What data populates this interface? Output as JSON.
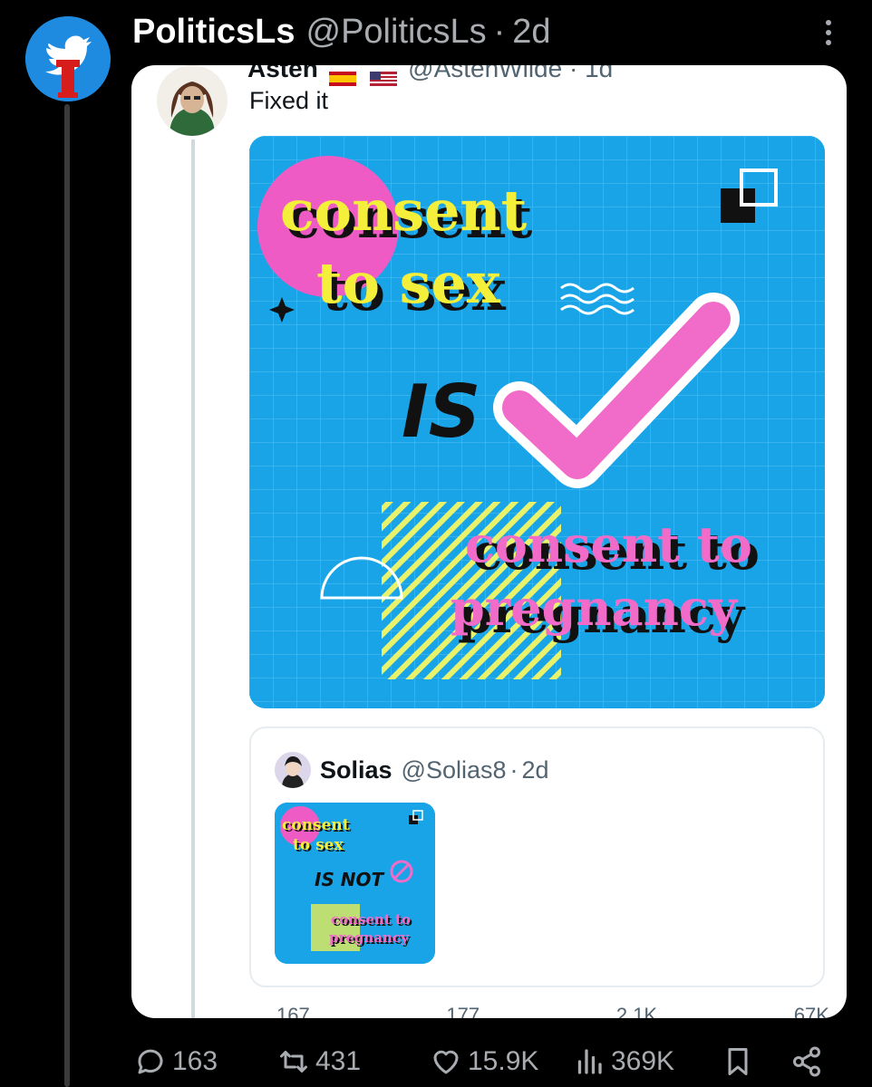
{
  "outer_tweet": {
    "name": "PoliticsLs",
    "handle": "@PoliticsLs",
    "separator": "·",
    "time": "2d"
  },
  "inner_tweet": {
    "name": "Asten",
    "handle": "@AstenWilde",
    "time": "1d",
    "text": "Fixed it"
  },
  "main_image": {
    "line1": "consent",
    "line2": "to sex",
    "middle": "IS",
    "line3": "consent to",
    "line4": "pregnancy"
  },
  "quote": {
    "name": "Solias",
    "handle": "@Solias8",
    "separator": "·",
    "time": "2d",
    "thumb_line1": "consent",
    "thumb_line2": "to sex",
    "thumb_middle": "IS NOT",
    "thumb_line3": "consent to",
    "thumb_line4": "pregnancy"
  },
  "inner_actions": {
    "replies": "167",
    "reposts": "177",
    "likes": "2.1K",
    "views": "67K"
  },
  "actions": {
    "replies": "163",
    "reposts": "431",
    "likes": "15.9K",
    "views": "369K"
  },
  "colors": {
    "image_blue": "#1aa4e8",
    "pink": "#f06cc8",
    "yellow": "#f3ef3a",
    "twitter_blue": "#1f8be0"
  }
}
